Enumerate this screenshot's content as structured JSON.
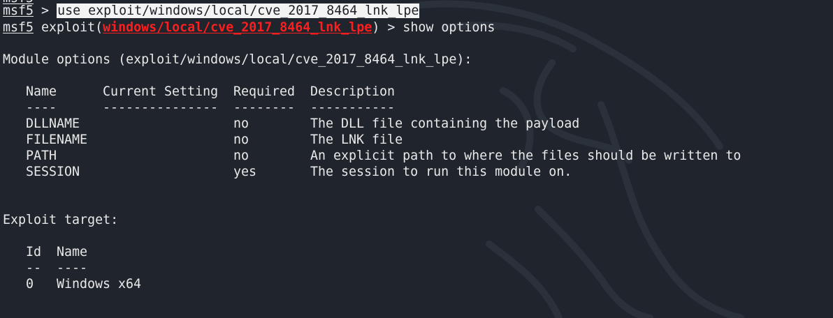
{
  "prompt": "msf5",
  "prev_line_partial": "msf5",
  "line1": {
    "sep": " > ",
    "command": "use exploit/windows/local/cve_2017_8464_lnk_lpe"
  },
  "line2": {
    "prefix": " exploit(",
    "module": "windows/local/cve_2017_8464_lnk_lpe",
    "suffix": ") > show options"
  },
  "module_header": "Module options (exploit/windows/local/cve_2017_8464_lnk_lpe):",
  "options_table": {
    "headers": [
      "Name",
      "Current Setting",
      "Required",
      "Description"
    ],
    "underlines": [
      "----",
      "---------------",
      "--------",
      "-----------"
    ],
    "rows": [
      {
        "name": "DLLNAME",
        "setting": "",
        "required": "no",
        "description": "The DLL file containing the payload"
      },
      {
        "name": "FILENAME",
        "setting": "",
        "required": "no",
        "description": "The LNK file"
      },
      {
        "name": "PATH",
        "setting": "",
        "required": "no",
        "description": "An explicit path to where the files should be written to"
      },
      {
        "name": "SESSION",
        "setting": "",
        "required": "yes",
        "description": "The session to run this module on."
      }
    ]
  },
  "target_header": "Exploit target:",
  "target_table": {
    "headers": [
      "Id",
      "Name"
    ],
    "underlines": [
      "--",
      "----"
    ],
    "rows": [
      {
        "id": "0",
        "name": "Windows x64"
      }
    ]
  },
  "colors": {
    "background": "#20252d",
    "text": "#e9e9e9",
    "module_red": "#ff1e1e",
    "highlight_bg": "#f3f3f3"
  }
}
